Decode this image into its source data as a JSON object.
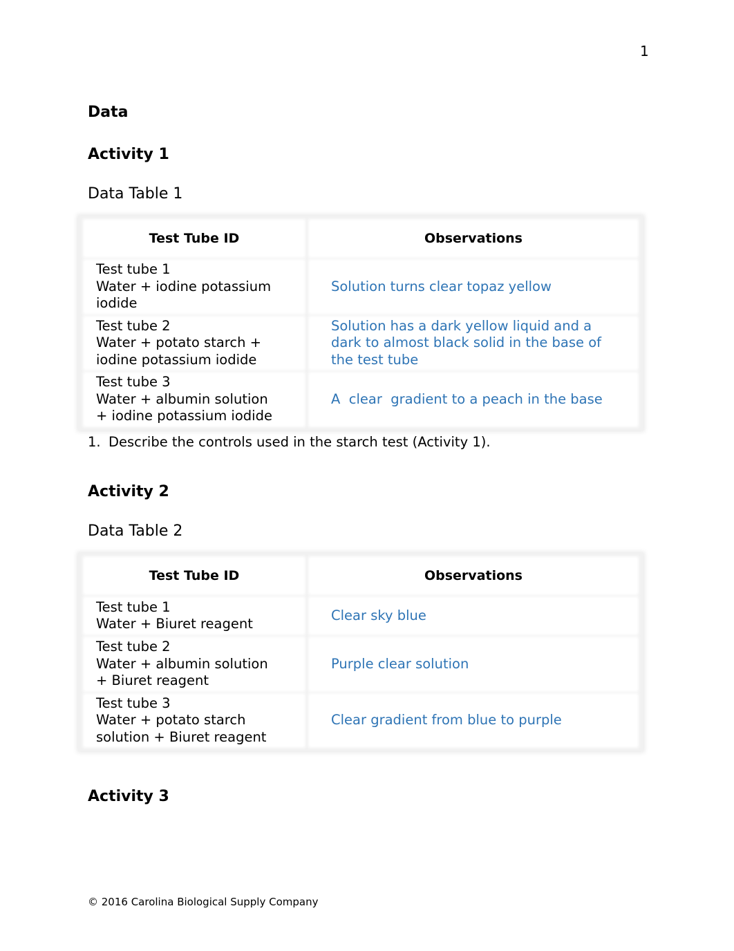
{
  "page_number": "1",
  "headings": {
    "data": "Data",
    "activity1": "Activity 1",
    "activity2": "Activity 2",
    "activity3": "Activity 3"
  },
  "table1": {
    "caption": "Data Table 1",
    "headers": [
      "Test Tube ID",
      "Observations"
    ],
    "rows": [
      {
        "id_lines": [
          "Test tube 1",
          "Water + iodine potassium",
          "iodide"
        ],
        "observation": "Solution turns clear topaz yellow"
      },
      {
        "id_lines": [
          "Test tube 2",
          "Water + potato starch +",
          "iodine potassium iodide"
        ],
        "observation_lines": [
          "Solution has a dark yellow liquid and a",
          "dark to almost black solid in the base of",
          "the test tube"
        ]
      },
      {
        "id_lines": [
          "Test tube 3",
          "Water + albumin solution",
          "+ iodine potassium iodide"
        ],
        "observation": "A  clear  gradient to a peach in the base"
      }
    ]
  },
  "question1": {
    "number": "1.",
    "text": "Describe the controls used in the starch test (Activity 1)."
  },
  "table2": {
    "caption": "Data Table 2",
    "headers": [
      "Test Tube ID",
      "Observations"
    ],
    "rows": [
      {
        "id_lines": [
          "Test tube 1",
          "Water + Biuret reagent"
        ],
        "observation": "Clear sky blue"
      },
      {
        "id_lines": [
          "Test tube 2",
          "Water + albumin solution",
          "+ Biuret reagent"
        ],
        "observation": "Purple clear solution"
      },
      {
        "id_lines": [
          "Test tube 3",
          "Water + potato starch",
          "solution + Biuret reagent"
        ],
        "observation": "Clear gradient from blue to purple"
      }
    ]
  },
  "colors": {
    "answer_text": "#2E74B5"
  },
  "footer": "© 2016 Carolina Biological Supply Company"
}
